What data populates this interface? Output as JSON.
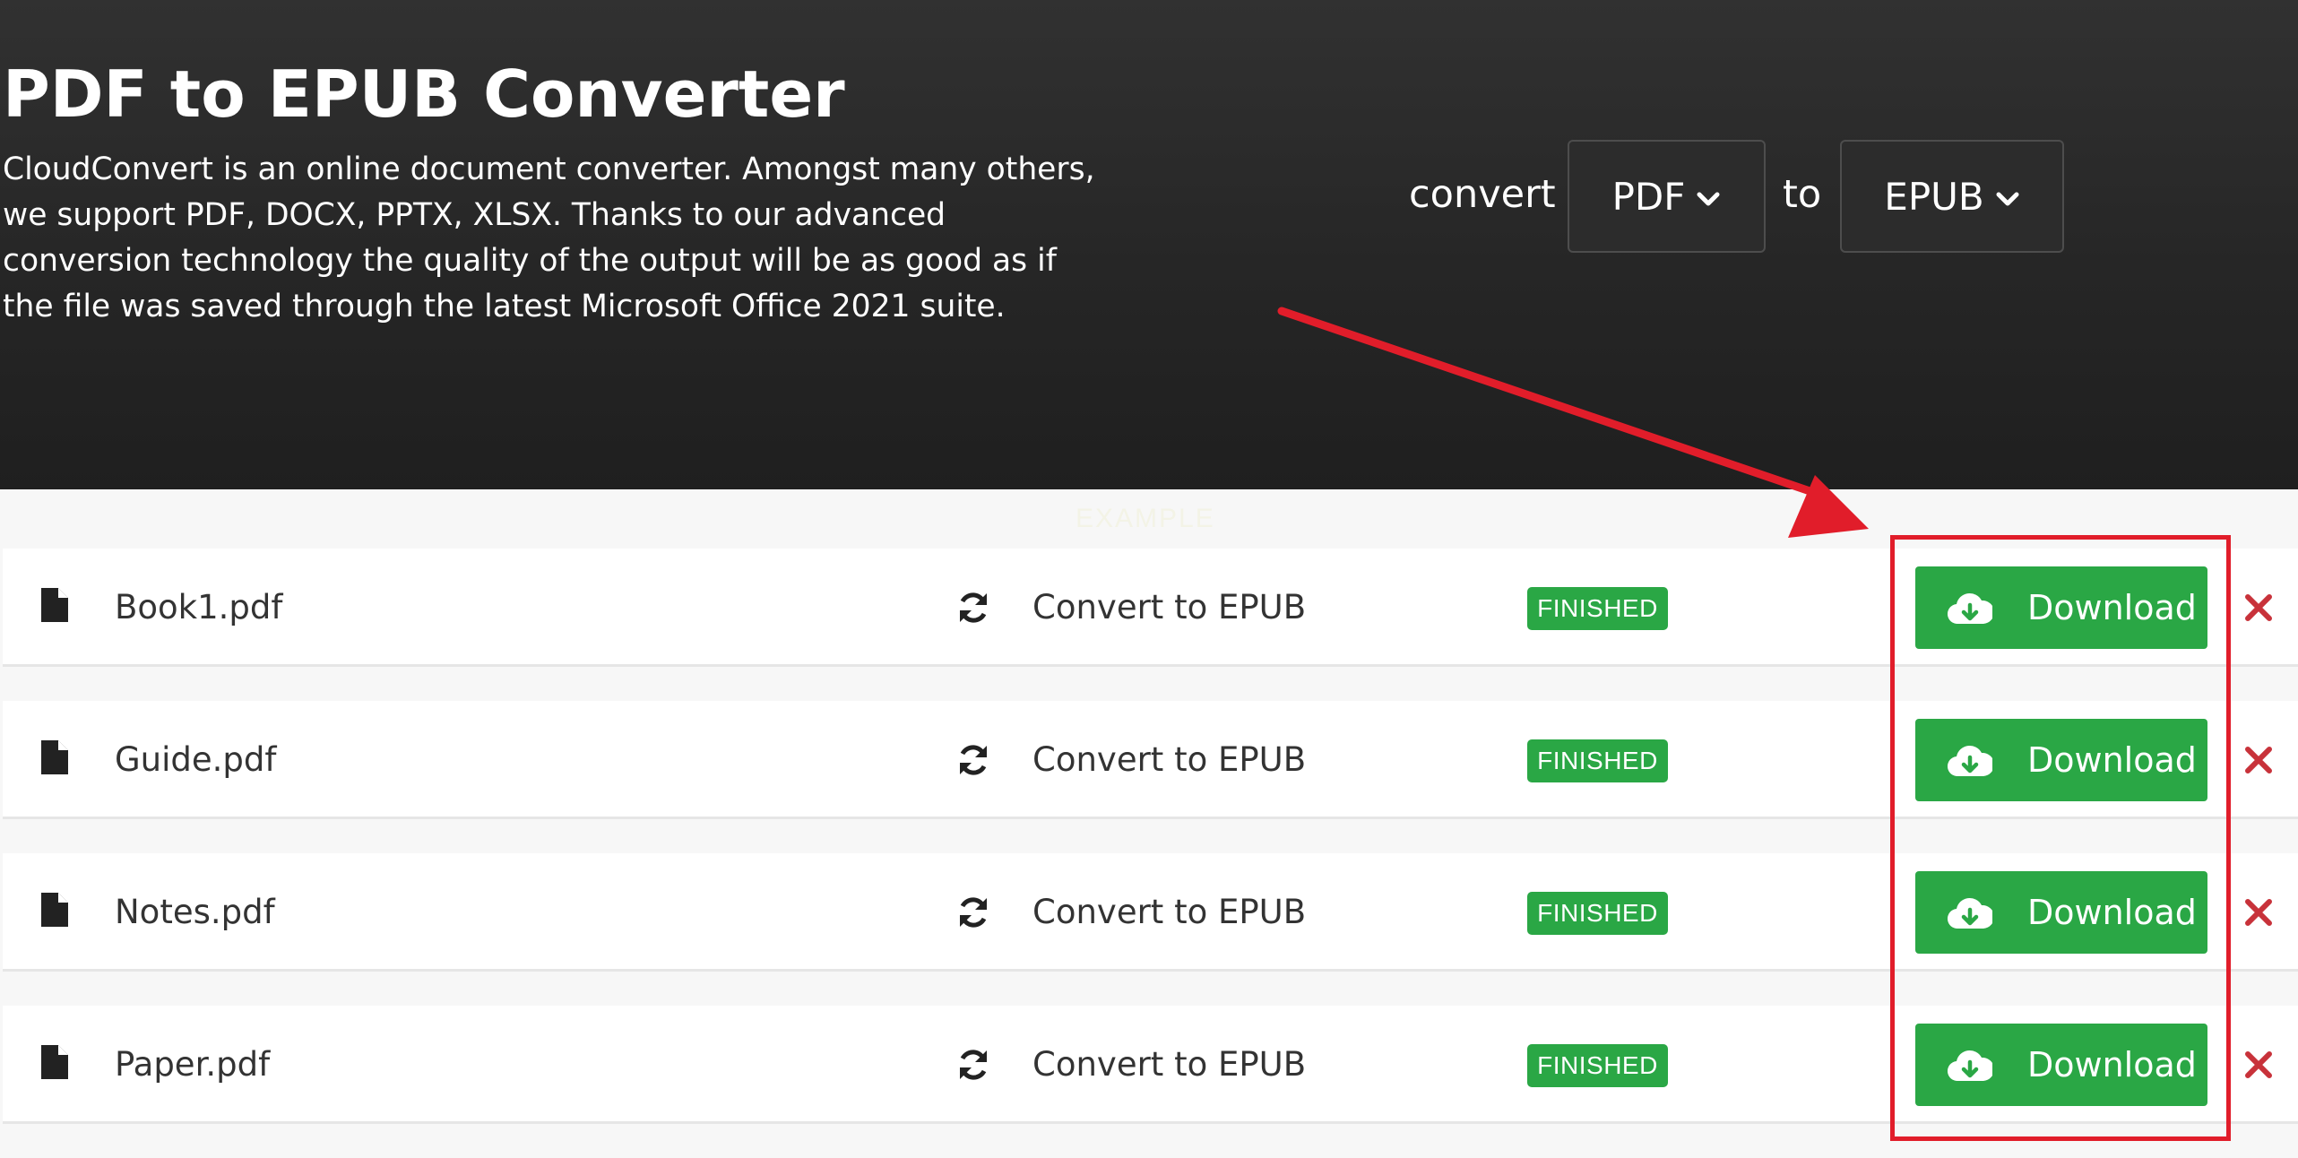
{
  "header": {
    "title": "PDF to EPUB Converter",
    "description": "CloudConvert is an online document converter. Amongst many others, we support PDF, DOCX, PPTX, XLSX. Thanks to our advanced conversion technology the quality of the output will be as good as if the file was saved through the latest Microsoft Office 2021 suite.",
    "convert_label": "convert",
    "to_label": "to",
    "from_format": "PDF",
    "to_format": "EPUB"
  },
  "faint_label": "EXAMPLE",
  "files": [
    {
      "name": "Book1.pdf",
      "action": "Convert to EPUB",
      "status": "FINISHED",
      "download_label": "Download"
    },
    {
      "name": "Guide.pdf",
      "action": "Convert to EPUB",
      "status": "FINISHED",
      "download_label": "Download"
    },
    {
      "name": "Notes.pdf",
      "action": "Convert to EPUB",
      "status": "FINISHED",
      "download_label": "Download"
    },
    {
      "name": "Paper.pdf",
      "action": "Convert to EPUB",
      "status": "FINISHED",
      "download_label": "Download"
    }
  ],
  "icons": {
    "file": "file-icon",
    "convert": "refresh-icon",
    "download": "cloud-download-icon",
    "remove": "close-icon",
    "dropdown": "chevron-down-icon"
  },
  "colors": {
    "header_bg": "#262626",
    "success": "#2aa745",
    "remove": "#c8323a",
    "annotation": "#e11d2a"
  }
}
